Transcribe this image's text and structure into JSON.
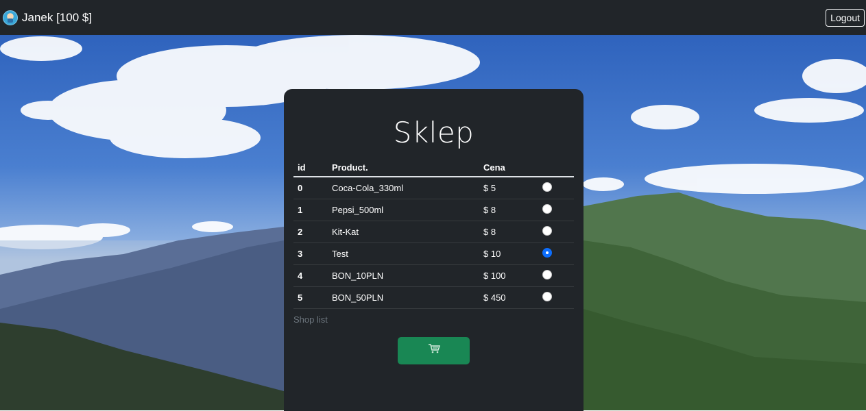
{
  "navbar": {
    "user_label": "Janek [100 $]",
    "logout_label": "Logout"
  },
  "shop": {
    "title": "Sklep",
    "columns": [
      "id",
      "Product.",
      "Cena"
    ],
    "products": [
      {
        "id": "0",
        "name": "Coca-Cola_330ml",
        "price": "$ 5",
        "selected": false
      },
      {
        "id": "1",
        "name": "Pepsi_500ml",
        "price": "$ 8",
        "selected": false
      },
      {
        "id": "2",
        "name": "Kit-Kat",
        "price": "$ 8",
        "selected": false
      },
      {
        "id": "3",
        "name": "Test",
        "price": "$ 10",
        "selected": true
      },
      {
        "id": "4",
        "name": "BON_10PLN",
        "price": "$ 100",
        "selected": false
      },
      {
        "id": "5",
        "name": "BON_50PLN",
        "price": "$ 450",
        "selected": false
      }
    ],
    "caption": "Shop list",
    "buy_button_icon": "cart-icon"
  },
  "colors": {
    "navbar_bg": "#212529",
    "card_bg": "#212529",
    "buy_button": "#198754",
    "radio_checked": "#0d6efd"
  }
}
